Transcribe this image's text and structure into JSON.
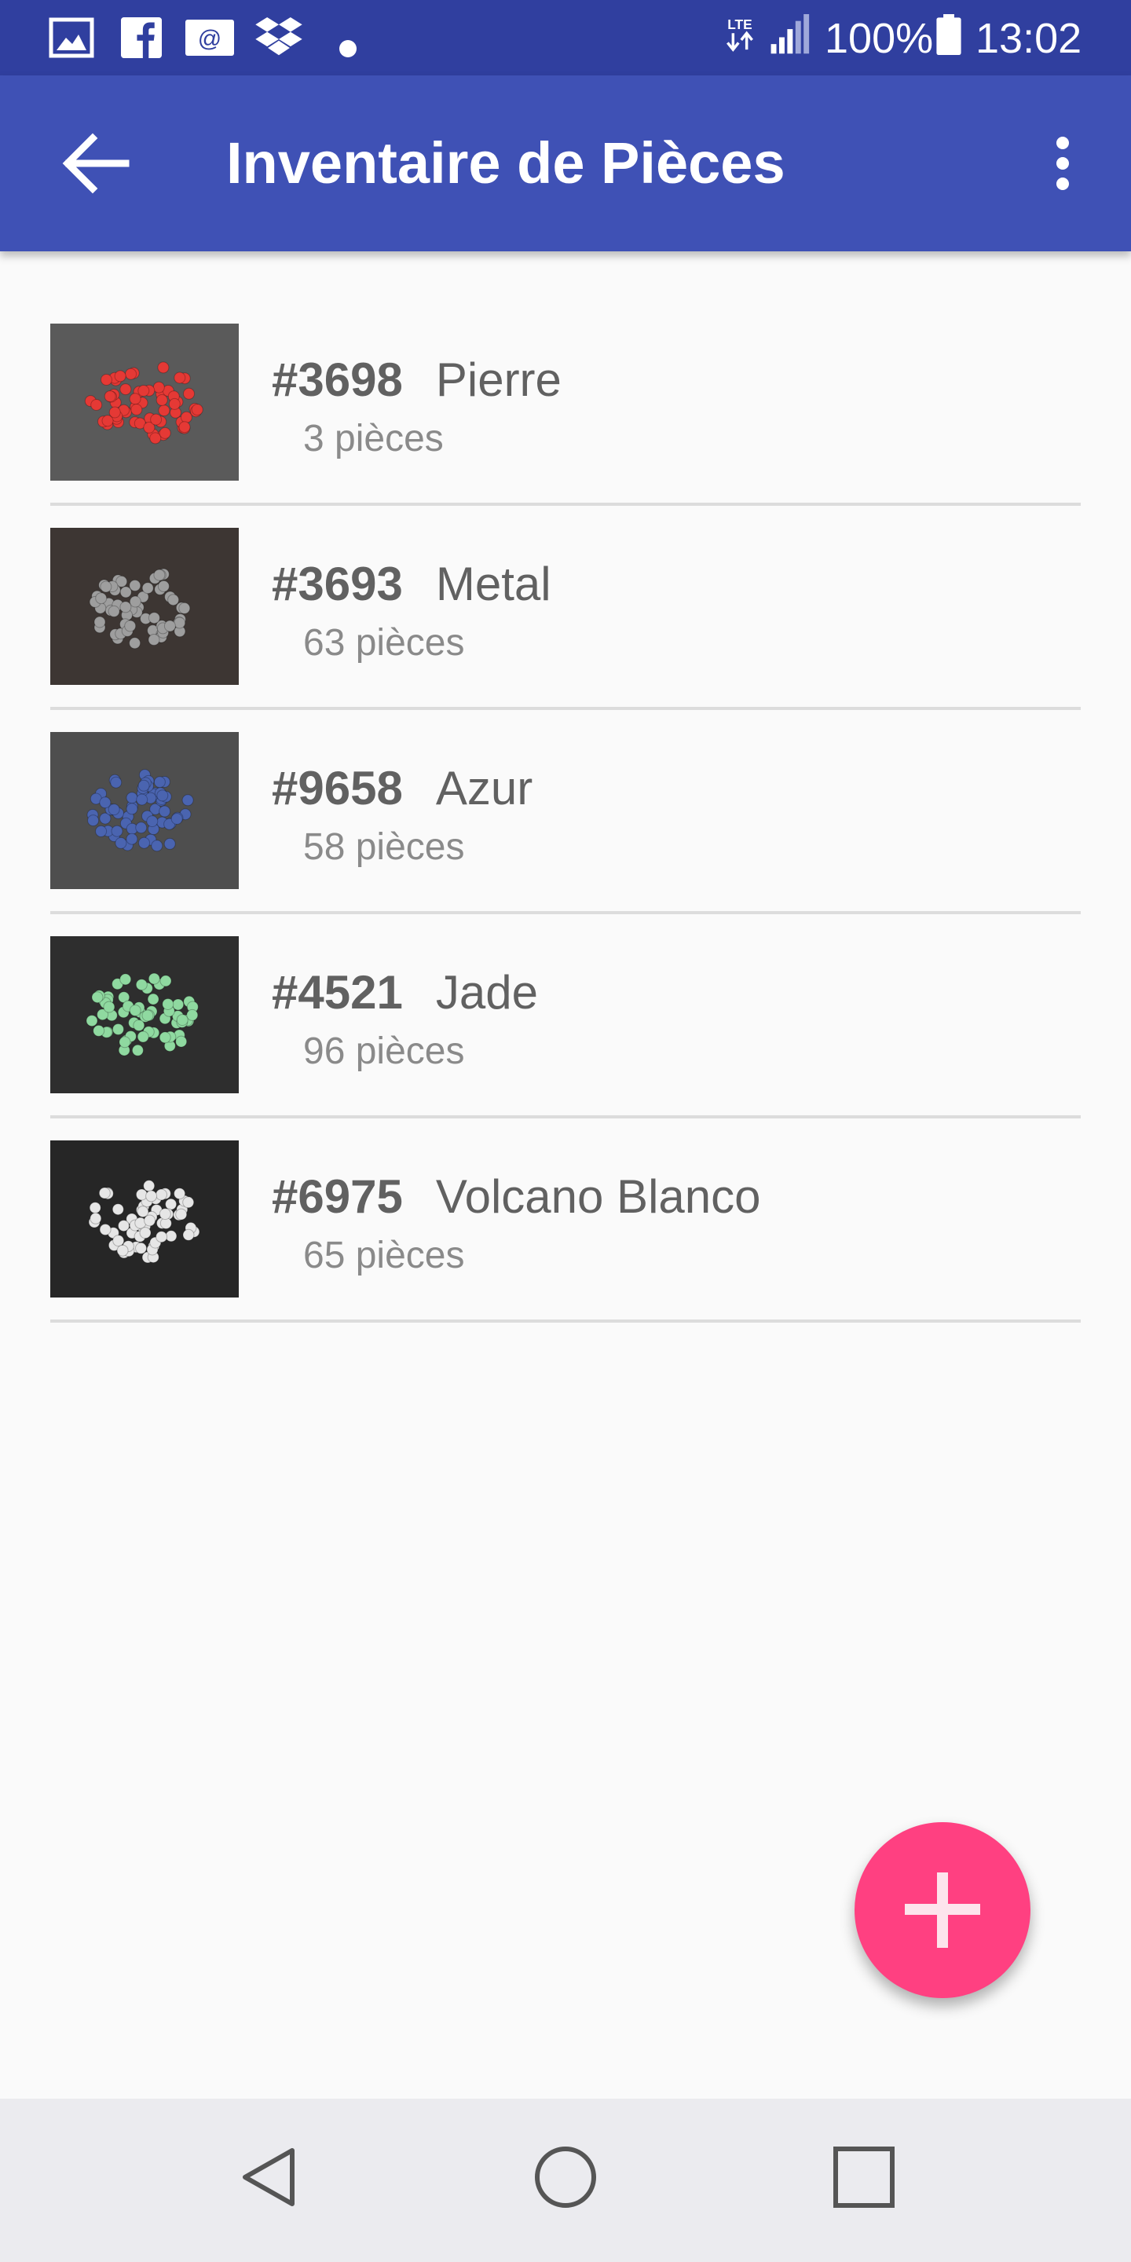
{
  "status_bar": {
    "network": "LTE",
    "battery_percent": "100%",
    "time": "13:02",
    "notification_icons": [
      "image-icon",
      "facebook-icon",
      "email-icon",
      "dropbox-icon",
      "dot-icon"
    ]
  },
  "app_bar": {
    "title": "Inventaire de Pièces"
  },
  "items": [
    {
      "code": "#3698",
      "name": "Pierre",
      "count": "3 pièces",
      "bead_color": "#e53935",
      "bg_color": "#5a5a5a"
    },
    {
      "code": "#3693",
      "name": "Metal",
      "count": "63 pièces",
      "bead_color": "#9e9e9e",
      "bg_color": "#3d3633"
    },
    {
      "code": "#9658",
      "name": "Azur",
      "count": "58 pièces",
      "bead_color": "#4a64b0",
      "bg_color": "#4e4e4e"
    },
    {
      "code": "#4521",
      "name": "Jade",
      "count": "96 pièces",
      "bead_color": "#8fd9a0",
      "bg_color": "#2e2e2e"
    },
    {
      "code": "#6975",
      "name": "Volcano Blanco",
      "count": "65 pièces",
      "bead_color": "#e6e6e6",
      "bg_color": "#262626"
    }
  ],
  "colors": {
    "status_bar": "#303f9f",
    "app_bar": "#3f51b5",
    "fab": "#ff4081"
  }
}
